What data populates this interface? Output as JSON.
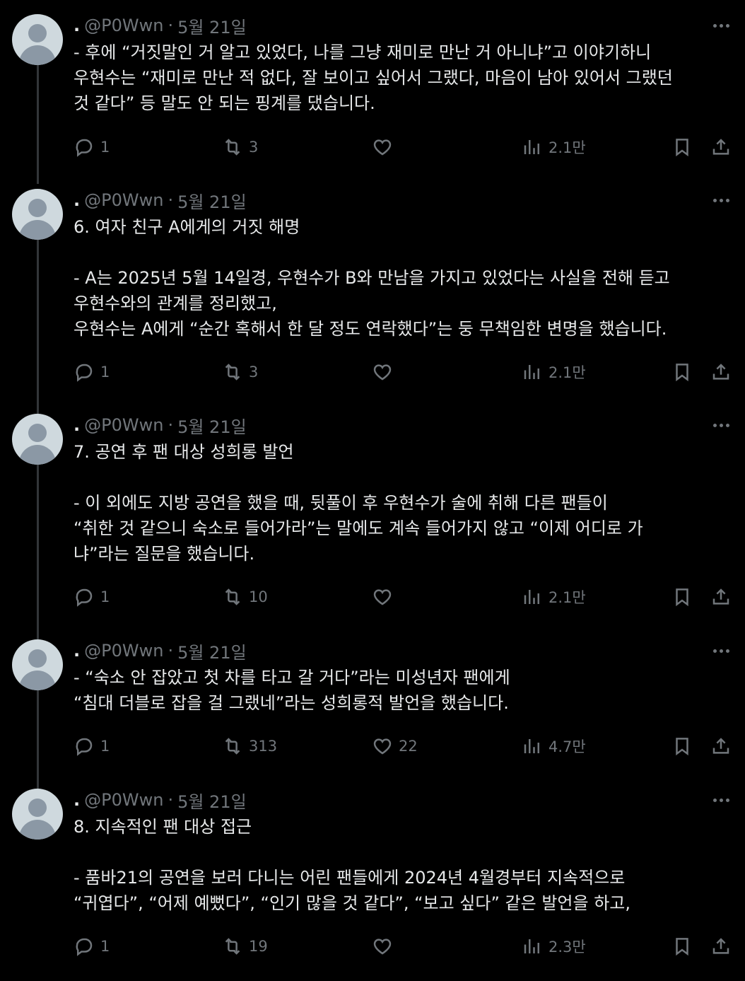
{
  "tweets": [
    {
      "dot": ".",
      "handle": "@P0Wwn",
      "date": "5월 21일",
      "text": "- 후에 “거짓말인 거 알고 있었다, 나를 그냥 재미로 만난 거 아니냐”고 이야기하니\n우현수는 “재미로 만난 적 없다, 잘 보이고 싶어서 그랬다, 마음이 남아 있어서 그랬던\n것 같다” 등 말도 안 되는 핑계를 댔습니다.",
      "replies": "1",
      "retweets": "3",
      "likes": "",
      "views": "2.1만"
    },
    {
      "dot": ".",
      "handle": "@P0Wwn",
      "date": "5월 21일",
      "text": "6. 여자 친구 A에게의 거짓 해명\n\n- A는 2025년 5월 14일경, 우현수가 B와 만남을 가지고 있었다는 사실을 전해 듣고\n우현수와의 관계를 정리했고,\n우현수는 A에게 “순간 혹해서 한 달 정도 연락했다”는 둥 무책임한 변명을 했습니다.",
      "replies": "1",
      "retweets": "3",
      "likes": "",
      "views": "2.1만"
    },
    {
      "dot": ".",
      "handle": "@P0Wwn",
      "date": "5월 21일",
      "text": "7. 공연 후 팬 대상 성희롱 발언\n\n- 이 외에도 지방 공연을 했을 때, 뒷풀이 후 우현수가 술에 취해 다른 팬들이\n“취한 것 같으니 숙소로 들어가라”는 말에도 계속 들어가지 않고 “이제 어디로 가\n냐”라는 질문을 했습니다.",
      "replies": "1",
      "retweets": "10",
      "likes": "",
      "views": "2.1만"
    },
    {
      "dot": ".",
      "handle": "@P0Wwn",
      "date": "5월 21일",
      "text": "- “숙소 안 잡았고 첫 차를 타고 갈 거다”라는 미성년자 팬에게\n“침대 더블로 잡을 걸 그랬네”라는 성희롱적 발언을 했습니다.",
      "replies": "1",
      "retweets": "313",
      "likes": "22",
      "views": "4.7만"
    },
    {
      "dot": ".",
      "handle": "@P0Wwn",
      "date": "5월 21일",
      "text": "8. 지속적인 팬 대상 접근\n\n- 품바21의 공연을 보러 다니는 어린 팬들에게 2024년 4월경부터 지속적으로\n“귀엽다”, “어제 예뻤다”, “인기 많을 것 같다”, “보고 싶다” 같은 발언을 하고,",
      "replies": "1",
      "retweets": "19",
      "likes": "",
      "views": "2.3만"
    }
  ],
  "icons": {
    "reply": "reply-icon",
    "retweet": "retweet-icon",
    "like": "heart-icon",
    "views": "views-icon",
    "bookmark": "bookmark-icon",
    "share": "share-icon",
    "more": "more-icon",
    "avatar": "default-avatar-icon"
  },
  "colors": {
    "background": "#000000",
    "text": "#e7e9ea",
    "muted": "#71767b",
    "thread_line": "#333639",
    "avatar_bg": "#cfd9de"
  }
}
